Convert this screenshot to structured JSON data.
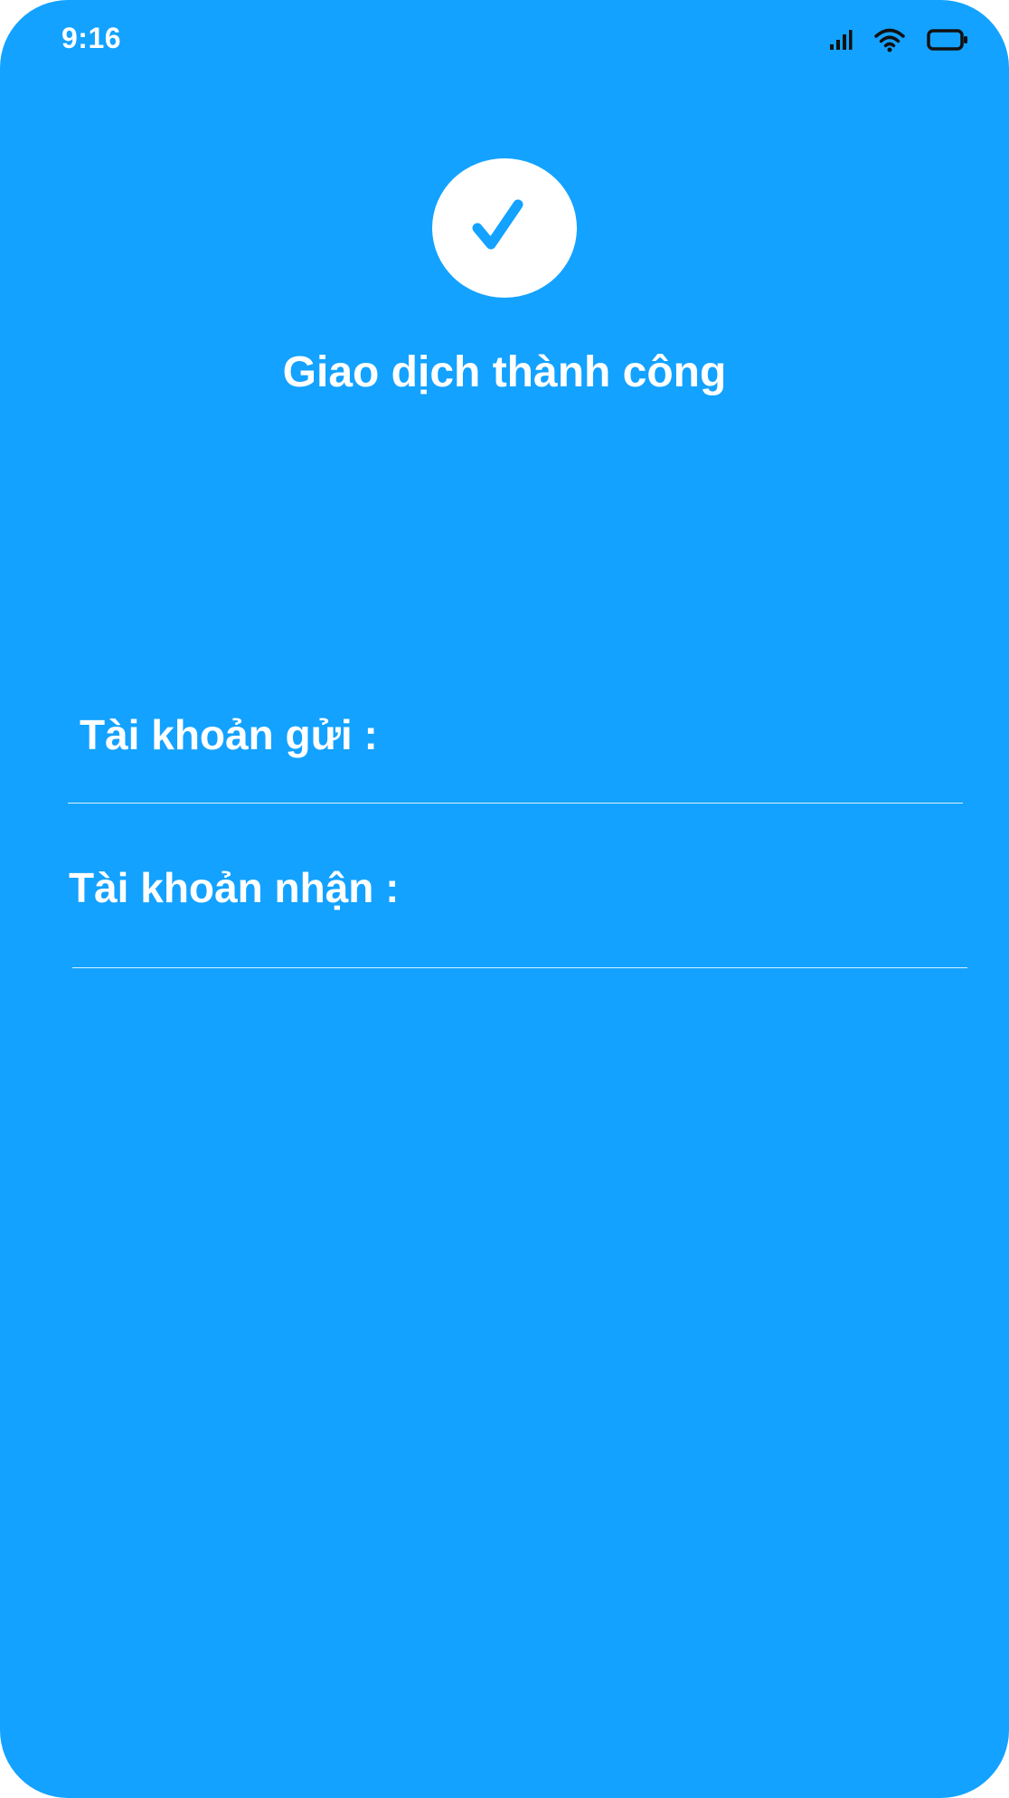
{
  "status_bar": {
    "time": "9:16",
    "icons": [
      "cellular-signal-icon",
      "wifi-icon",
      "battery-icon"
    ]
  },
  "colors": {
    "background": "#13A2FF",
    "foreground": "#FFFFFF",
    "checkmark": "#13A2FF"
  },
  "success": {
    "icon": "checkmark-icon",
    "title": "Giao dịch thành công"
  },
  "fields": {
    "sender_label": "Tài khoản gửi :",
    "receiver_label": "Tài khoản nhận :"
  }
}
